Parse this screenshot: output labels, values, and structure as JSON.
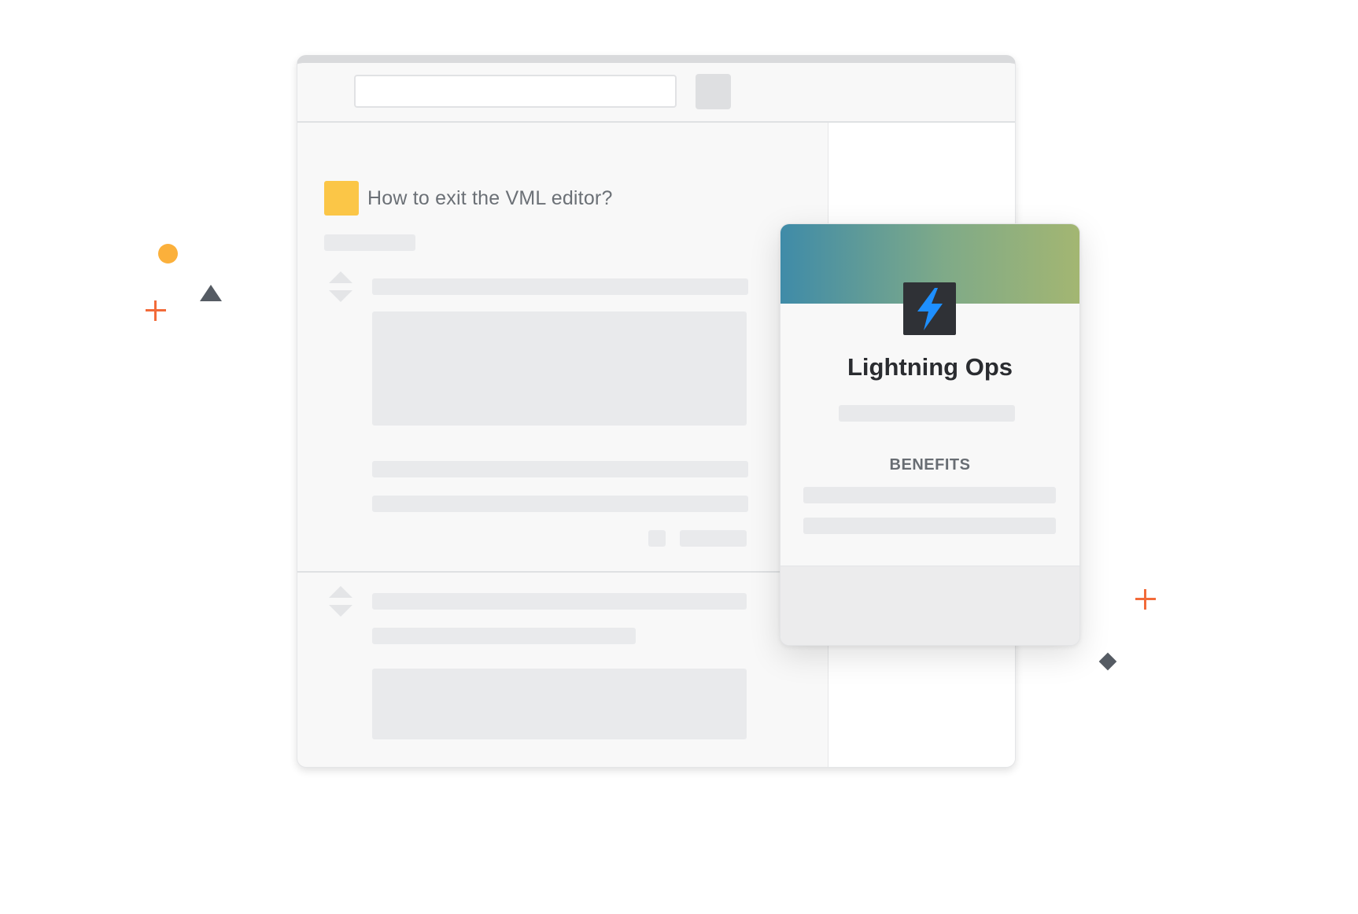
{
  "question": {
    "title": "How to exit the VML editor?"
  },
  "product_card": {
    "name": "Lightning Ops",
    "section_heading": "BENEFITS",
    "logo_icon": "lightning-bolt-icon",
    "banner_gradient": [
      "#3f8ba8",
      "#7faa88",
      "#a3b672"
    ]
  },
  "colors": {
    "accent_yellow": "#fbc647",
    "bolt_blue": "#1e8fff",
    "deco_orange": "#fbb03b",
    "deco_red_orange": "#f26b3a",
    "deco_dark": "#555b63"
  },
  "decorations": [
    "orange-dot",
    "dark-triangle",
    "orange-plus-left",
    "orange-plus-right",
    "dark-diamond"
  ]
}
